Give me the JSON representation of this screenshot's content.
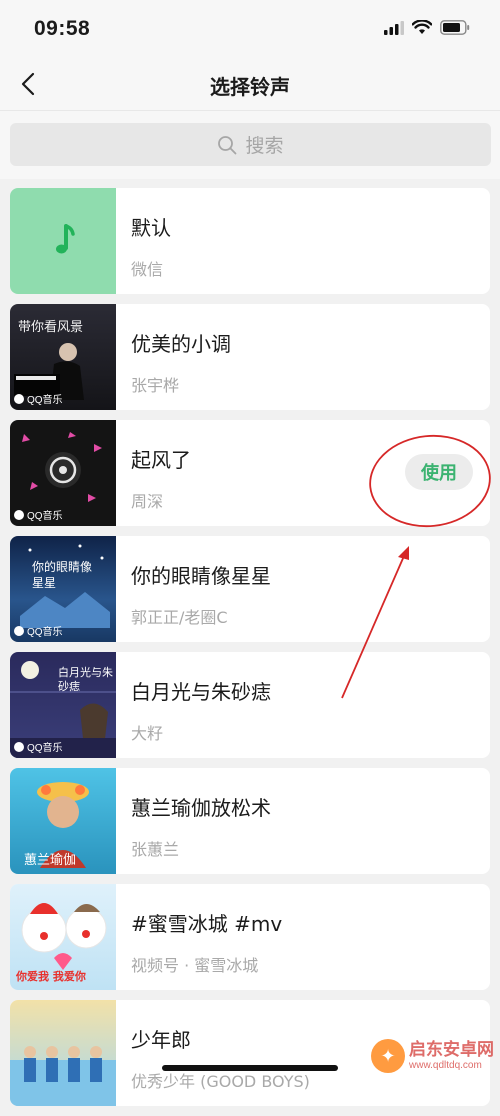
{
  "status_bar": {
    "time": "09:58",
    "icons": [
      "signal-icon",
      "wifi-icon",
      "battery-icon"
    ]
  },
  "nav": {
    "title": "选择铃声",
    "back_icon": "chevron-left-icon"
  },
  "search": {
    "placeholder": "搜索",
    "icon": "search-icon"
  },
  "ringtones": [
    {
      "title": "默认",
      "subtitle": "微信",
      "cover": "music-note-icon",
      "cover_color": "#8fdcae",
      "tag": ""
    },
    {
      "title": "优美的小调",
      "subtitle": "张宇桦",
      "cover": "piano-cover",
      "cover_color": "#1c1c22",
      "tag": "QQ音乐",
      "cover_text": "带你看风景"
    },
    {
      "title": "起风了",
      "subtitle": "周深",
      "cover": "vinyl-cover",
      "cover_color": "#141414",
      "tag": "QQ音乐",
      "use_label": "使用"
    },
    {
      "title": "你的眼睛像星星",
      "subtitle": "郭正正/老圈C",
      "cover": "starry-cover",
      "cover_color": "#1e3a66",
      "tag": "QQ音乐",
      "cover_text": "你的眼睛像星星"
    },
    {
      "title": "白月光与朱砂痣",
      "subtitle": "大籽",
      "cover": "moon-cover",
      "cover_color": "#2a2a5c",
      "tag": "QQ音乐",
      "cover_text": "白月光与朱砂痣"
    },
    {
      "title": "蕙兰瑜伽放松术",
      "subtitle": "张蕙兰",
      "cover": "yoga-cover",
      "cover_color": "#2fa6c9",
      "tag": "",
      "cover_text": "蕙兰瑜伽"
    },
    {
      "title": "#蜜雪冰城 #mv",
      "subtitle": "视频号 · 蜜雪冰城",
      "cover": "snowman-cover",
      "cover_color": "#cfe9f7",
      "tag": "",
      "cover_text": "你爱我 我爱你"
    },
    {
      "title": "少年郎",
      "subtitle": "优秀少年 (GOOD BOYS)",
      "cover": "boys-cover",
      "cover_color": "#a7d7ee",
      "tag": ""
    }
  ],
  "watermark": {
    "name": "启东安卓网",
    "url": "www.qdltdq.com"
  },
  "colors": {
    "accent": "#3cb371",
    "annotation": "#d62828",
    "background": "#f1f1f1"
  }
}
